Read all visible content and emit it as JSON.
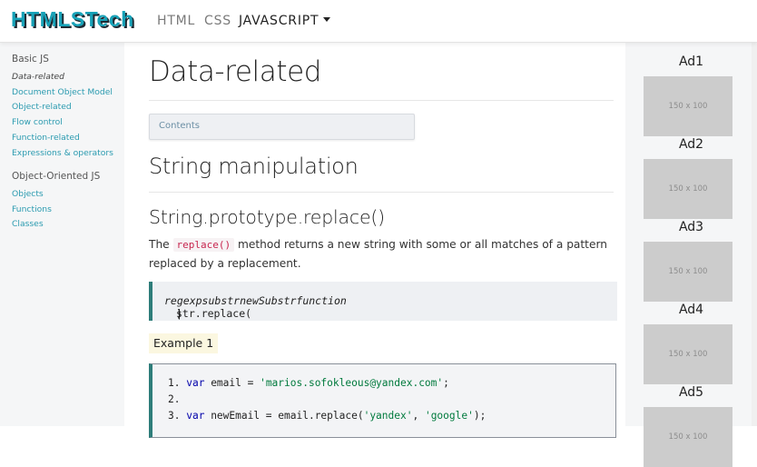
{
  "nav": {
    "brand": "HTMLSTech",
    "links": [
      "HTML",
      "CSS",
      "JAVASCRIPT"
    ]
  },
  "sidebar": {
    "sections": [
      {
        "heading": "Basic JS",
        "items": [
          "Data-related",
          "Document Object Model",
          "Object-related",
          "Flow control",
          "Function-related",
          "Expressions & operators"
        ]
      },
      {
        "heading": "Object-Oriented JS",
        "items": [
          "Objects",
          "Functions",
          "Classes"
        ]
      }
    ]
  },
  "main": {
    "title": "Data-related",
    "contents_label": "Contents",
    "section_title": "String manipulation",
    "subsection_title": "String.prototype.replace()",
    "para_before": "The ",
    "para_code": "replace()",
    "para_after": " method returns a new string with some or all matches of a pattern replaced by a replacement.",
    "signature_prefix": "str.replace(",
    "signature_italic_1": "regexp",
    "signature_pipe_1": "|",
    "signature_italic_2": "substr",
    "signature_comma": ", ",
    "signature_italic_3": "newSubstr",
    "signature_pipe_2": "|",
    "signature_italic_4": "function",
    "signature_suffix": ")",
    "example_label": "Example 1",
    "code": {
      "line1_num": "1.",
      "line1_kw": "var",
      "line1_a": " email = ",
      "line1_str": "'marios.sofokleous@yandex.com'",
      "line1_end": ";",
      "line2_num": "2.",
      "line3_num": "3.",
      "line3_kw": "var",
      "line3_a": " newEmail = email.replace(",
      "line3_str1": "'yandex'",
      "line3_comma": ", ",
      "line3_str2": "'google'",
      "line3_end": ");"
    }
  },
  "ads": [
    {
      "title": "Ad1",
      "size": "150 x 100"
    },
    {
      "title": "Ad2",
      "size": "150 x 100"
    },
    {
      "title": "Ad3",
      "size": "150 x 100"
    },
    {
      "title": "Ad4",
      "size": "150 x 100"
    },
    {
      "title": "Ad5",
      "size": "150 x 100"
    }
  ],
  "colors": {
    "brand": "#17a2b8",
    "link": "#2b9bb0",
    "accent_border": "#2e7d7a",
    "code_red": "#c7254e"
  }
}
